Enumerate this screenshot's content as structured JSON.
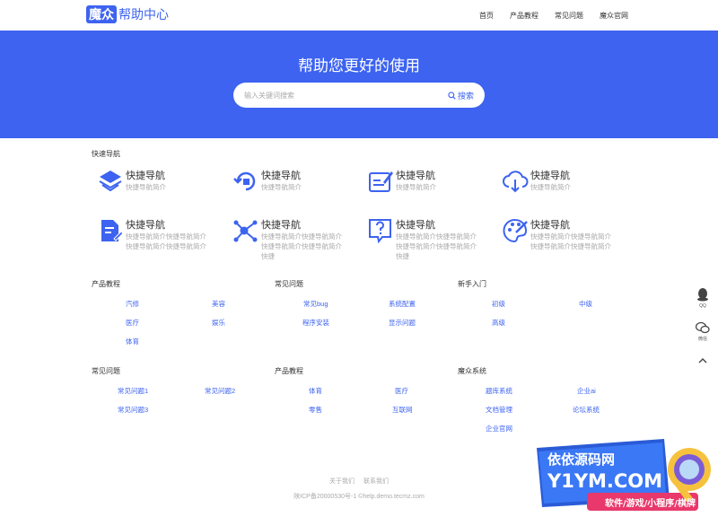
{
  "header": {
    "logo_mark": "魔众",
    "logo_text": "帮助中心",
    "nav": [
      "首页",
      "产品教程",
      "常见问题",
      "魔众官网"
    ]
  },
  "hero": {
    "title": "帮助您更好的使用",
    "search_placeholder": "输入关键词搜索",
    "search_button": "搜索"
  },
  "quick_nav": {
    "label": "快速导航",
    "items": [
      {
        "title": "快捷导航",
        "desc": "快捷导航简介",
        "icon": "layers-icon"
      },
      {
        "title": "快捷导航",
        "desc": "快捷导航简介",
        "icon": "rotate-icon"
      },
      {
        "title": "快捷导航",
        "desc": "快捷导航简介",
        "icon": "edit-note-icon"
      },
      {
        "title": "快捷导航",
        "desc": "快捷导航简介",
        "icon": "cloud-download-icon"
      },
      {
        "title": "快捷导航",
        "desc": "快捷导航简介快捷导航简介快捷导航简介快捷导航简介",
        "icon": "document-icon"
      },
      {
        "title": "快捷导航",
        "desc": "快捷导航简介快捷导航简介快捷导航简介快捷导航简介快捷",
        "icon": "network-icon"
      },
      {
        "title": "快捷导航",
        "desc": "快捷导航简介快捷导航简介快捷导航简介快捷导航简介快捷",
        "icon": "help-chat-icon"
      },
      {
        "title": "快捷导航",
        "desc": "快捷导航简介快捷导航简介快捷导航简介快捷导航简介",
        "icon": "palette-icon"
      }
    ]
  },
  "groups": [
    {
      "title": "产品教程",
      "links": [
        "汽修",
        "美容",
        "医疗",
        "娱乐",
        "体育"
      ]
    },
    {
      "title": "常见问题",
      "links": [
        "常见bug",
        "系统配置",
        "程序安装",
        "显示问题"
      ]
    },
    {
      "title": "新手入门",
      "links": [
        "初级",
        "中级",
        "高级"
      ]
    },
    {
      "title": "常见问题",
      "links": [
        "常见问题1",
        "常见问题2",
        "常见问题3"
      ]
    },
    {
      "title": "产品教程",
      "links": [
        "体育",
        "医疗",
        "零售",
        "互联网"
      ]
    },
    {
      "title": "魔众系统",
      "links": [
        "题库系统",
        "企业ai",
        "文档管理",
        "论坛系统",
        "企业官网"
      ]
    }
  ],
  "footer": {
    "links": [
      "关于我们",
      "联系我们"
    ],
    "copyright": "陕ICP备20000530号-1 ©help.demo.tecmz.com"
  },
  "side": {
    "qq_label": "QQ",
    "wechat_label": "微信"
  },
  "watermark": {
    "line1": "依依源码网",
    "line2": "Y1YM.COM",
    "line3": "软件/游戏/小程序/棋牌"
  },
  "colors": {
    "primary": "#3d63f0",
    "hero_bg": "#3d63f0",
    "muted": "#aaaaaa"
  }
}
